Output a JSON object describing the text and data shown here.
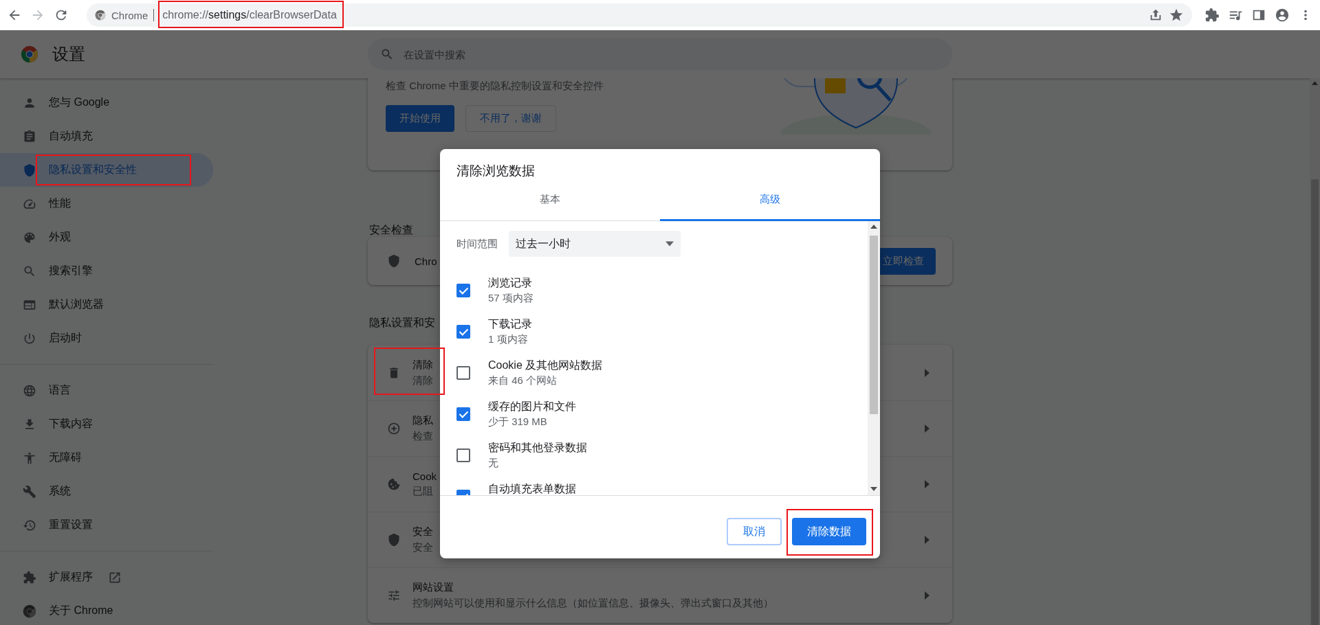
{
  "browser": {
    "forward": {
      "disabled": true
    },
    "address_bar": {
      "site_label": "Chrome",
      "url": "chrome://**settings**/clearBrowserData",
      "highlighted": true
    }
  },
  "header": {
    "title": "设置",
    "search": {
      "placeholder": "在设置中搜索"
    }
  },
  "sidebar": {
    "sections": [
      {
        "items": [
          {
            "label": "您与 Google",
            "selected": false,
            "highlighted": false
          },
          {
            "label": "自动填充",
            "selected": false,
            "highlighted": false
          },
          {
            "label": "隐私设置和安全性",
            "selected": true,
            "highlighted": true
          },
          {
            "label": "性能",
            "selected": false,
            "highlighted": false
          },
          {
            "label": "外观",
            "selected": false,
            "highlighted": false
          },
          {
            "label": "搜索引擎",
            "selected": false,
            "highlighted": false
          },
          {
            "label": "默认浏览器",
            "selected": false,
            "highlighted": false
          },
          {
            "label": "启动时",
            "selected": false,
            "highlighted": false
          }
        ]
      },
      {
        "items": [
          {
            "label": "语言",
            "selected": false,
            "highlighted": false
          },
          {
            "label": "下载内容",
            "selected": false,
            "highlighted": false
          },
          {
            "label": "无障碍",
            "selected": false,
            "highlighted": false
          },
          {
            "label": "系统",
            "selected": false,
            "highlighted": false
          },
          {
            "label": "重置设置",
            "selected": false,
            "highlighted": false
          }
        ]
      },
      {
        "items": [
          {
            "label": "扩展程序",
            "selected": false,
            "highlighted": false
          },
          {
            "label": "关于 Chrome",
            "selected": false,
            "highlighted": false
          }
        ]
      }
    ]
  },
  "main": {
    "privacy_guide": {
      "description": "检查 Chrome 中重要的隐私控制设置和安全控件",
      "buttons": [
        {
          "label": "开始使用",
          "kind": "primary"
        },
        {
          "label": "不用了，谢谢",
          "kind": "secondary"
        }
      ]
    },
    "safety_check": {
      "heading": "安全检查",
      "text": "Chro",
      "button": "立即检查"
    },
    "privacy": {
      "heading": "隐私设置和安",
      "rows": [
        {
          "title": "清除",
          "subtitle": "清除",
          "highlighted": true
        },
        {
          "title": "隐私",
          "subtitle": "检查",
          "highlighted": false
        },
        {
          "title": "Cook",
          "subtitle": "已阻",
          "highlighted": false
        },
        {
          "title": "安全",
          "subtitle": "安全",
          "highlighted": false
        },
        {
          "title": "网站设置",
          "subtitle": "控制网站可以使用和显示什么信息（如位置信息、摄像头、弹出式窗口及其他）",
          "highlighted": false
        }
      ]
    }
  },
  "dialog": {
    "title": "清除浏览数据",
    "tabs": [
      {
        "label": "基本",
        "selected": false
      },
      {
        "label": "高级",
        "selected": true
      }
    ],
    "time_range": {
      "label": "时间范围",
      "value": "过去一小时"
    },
    "items": [
      {
        "title": "浏览记录",
        "detail": "57 项内容",
        "checked": true
      },
      {
        "title": "下载记录",
        "detail": "1 项内容",
        "checked": true
      },
      {
        "title": "Cookie 及其他网站数据",
        "detail": "来自 46 个网站",
        "checked": false
      },
      {
        "title": "缓存的图片和文件",
        "detail": "少于 319 MB",
        "checked": true
      },
      {
        "title": "密码和其他登录数据",
        "detail": "无",
        "checked": false
      },
      {
        "title": "自动填充表单数据",
        "checked": true
      }
    ],
    "buttons": [
      {
        "label": "取消",
        "kind": "secondary",
        "highlighted": false
      },
      {
        "label": "清除数据",
        "kind": "primary",
        "highlighted": true
      }
    ]
  }
}
